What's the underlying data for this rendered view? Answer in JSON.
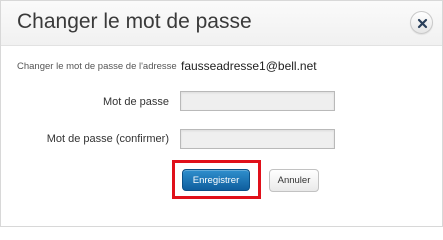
{
  "dialog": {
    "title": "Changer le mot de passe",
    "close_icon": "close-icon"
  },
  "form": {
    "email_label": "Changer le mot de passe de l'adresse",
    "email_value": "fausseadresse1@bell.net",
    "password_label": "Mot de passe",
    "password_value": "",
    "confirm_label": "Mot de passe (confirmer)",
    "confirm_value": ""
  },
  "actions": {
    "save_label": "Enregistrer",
    "cancel_label": "Annuler"
  },
  "colors": {
    "primary_button": "#1a74b6",
    "highlight_border": "#e0101a"
  }
}
